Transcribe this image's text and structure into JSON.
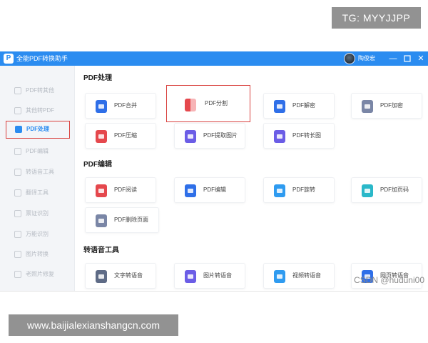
{
  "watermarks": {
    "top": "TG: MYYJJPP",
    "bottom": "www.baijialexianshangcn.com",
    "csdn": "CSDN @huduni00"
  },
  "window": {
    "title": "全能PDF转换助手",
    "user_name": "陶俊宏",
    "min_label": "—",
    "close_label": "✕"
  },
  "sidebar": {
    "items": [
      {
        "label": "PDF转其他",
        "icon": "convert-icon"
      },
      {
        "label": "其他转PDF",
        "icon": "import-icon"
      },
      {
        "label": "PDF处理",
        "icon": "pdf-process-icon",
        "active": true
      },
      {
        "label": "PDF编辑",
        "icon": "edit-icon"
      },
      {
        "label": "转语音工具",
        "icon": "voice-icon"
      },
      {
        "label": "翻译工具",
        "icon": "translate-icon"
      },
      {
        "label": "票证识别",
        "icon": "ticket-icon"
      },
      {
        "label": "万能识别",
        "icon": "ocr-icon"
      },
      {
        "label": "图片转换",
        "icon": "image-icon"
      },
      {
        "label": "老照片修复",
        "icon": "photo-repair-icon"
      }
    ]
  },
  "sections": [
    {
      "title": "PDF处理",
      "cards": [
        {
          "label": "PDF合并",
          "icon": "merge-icon",
          "color": "#2f6fe8"
        },
        {
          "label": "PDF分割",
          "icon": "split-icon",
          "color": "#e5484d",
          "selected": true
        },
        {
          "label": "PDF解密",
          "icon": "unlock-icon",
          "color": "#2f6fe8"
        },
        {
          "label": "PDF加密",
          "icon": "lock-icon",
          "color": "#7a86a6"
        },
        {
          "label": "PDF压缩",
          "icon": "compress-icon",
          "color": "#e5484d"
        },
        {
          "label": "PDF提取图片",
          "icon": "extract-image-icon",
          "color": "#6b5de6"
        },
        {
          "label": "PDF转长图",
          "icon": "long-image-icon",
          "color": "#6b5de6"
        }
      ]
    },
    {
      "title": "PDF编辑",
      "cards": [
        {
          "label": "PDF阅读",
          "icon": "read-icon",
          "color": "#e5484d"
        },
        {
          "label": "PDF编辑",
          "icon": "pen-icon",
          "color": "#2f6fe8"
        },
        {
          "label": "PDF旋转",
          "icon": "rotate-icon",
          "color": "#2f9bf0"
        },
        {
          "label": "PDF加页码",
          "icon": "page-number-icon",
          "color": "#2ab8c9"
        },
        {
          "label": "PDF删除页面",
          "icon": "delete-page-icon",
          "color": "#7a86a6"
        }
      ]
    },
    {
      "title": "转语音工具",
      "cards": [
        {
          "label": "文字转语音",
          "icon": "text-speech-icon",
          "color": "#5e6b86"
        },
        {
          "label": "图片转语音",
          "icon": "image-speech-icon",
          "color": "#6b5de6"
        },
        {
          "label": "视频转语音",
          "icon": "video-speech-icon",
          "color": "#2f9bf0"
        },
        {
          "label": "网页转语音",
          "icon": "web-speech-icon",
          "color": "#2f6fe8"
        }
      ]
    }
  ]
}
